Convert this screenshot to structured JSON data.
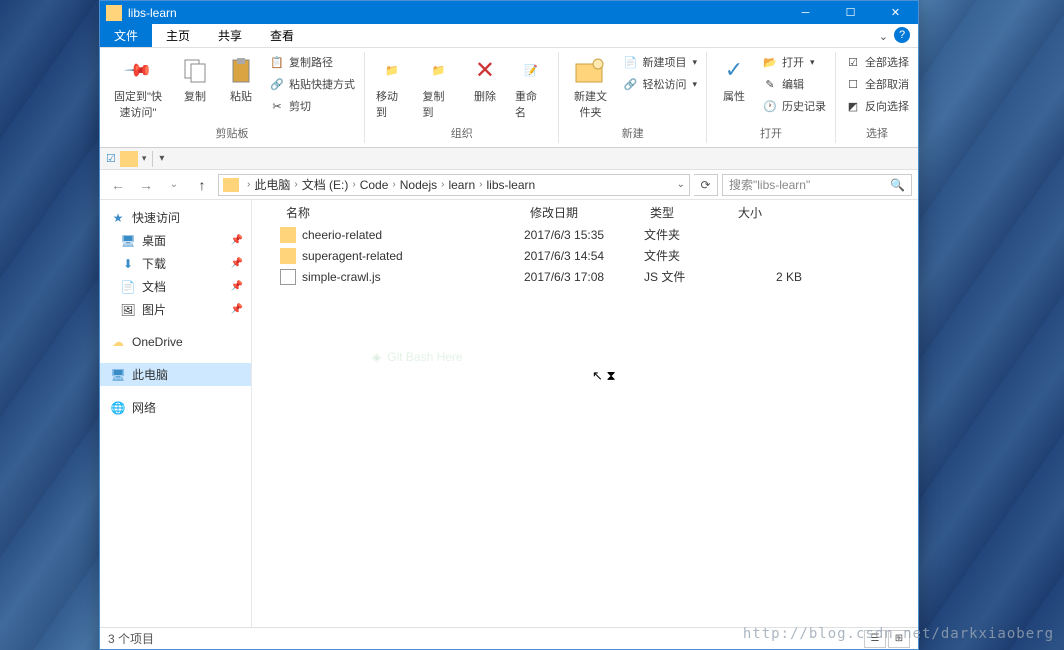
{
  "title": "libs-learn",
  "tabs": {
    "file": "文件",
    "home": "主页",
    "share": "共享",
    "view": "查看"
  },
  "ribbon": {
    "pin": "固定到\"快速访问\"",
    "copy": "复制",
    "paste": "粘贴",
    "copyPath": "复制路径",
    "pasteShortcut": "粘贴快捷方式",
    "cut": "剪切",
    "clipboard": "剪贴板",
    "moveTo": "移动到",
    "copyTo": "复制到",
    "delete": "删除",
    "rename": "重命名",
    "organize": "组织",
    "newFolder": "新建文件夹",
    "newItem": "新建项目",
    "easyAccess": "轻松访问",
    "new": "新建",
    "properties": "属性",
    "open": "打开",
    "edit": "编辑",
    "history": "历史记录",
    "openGroup": "打开",
    "selectAll": "全部选择",
    "selectNone": "全部取消",
    "invertSelection": "反向选择",
    "select": "选择"
  },
  "breadcrumb": [
    "此电脑",
    "文档 (E:)",
    "Code",
    "Nodejs",
    "learn",
    "libs-learn"
  ],
  "searchPlaceholder": "搜索\"libs-learn\"",
  "nav": {
    "quickAccess": "快速访问",
    "desktop": "桌面",
    "downloads": "下载",
    "documents": "文档",
    "pictures": "图片",
    "onedrive": "OneDrive",
    "thisPC": "此电脑",
    "network": "网络"
  },
  "columns": {
    "name": "名称",
    "date": "修改日期",
    "type": "类型",
    "size": "大小"
  },
  "files": [
    {
      "name": "cheerio-related",
      "date": "2017/6/3 15:35",
      "type": "文件夹",
      "size": "",
      "icon": "folder"
    },
    {
      "name": "superagent-related",
      "date": "2017/6/3 14:54",
      "type": "文件夹",
      "size": "",
      "icon": "folder"
    },
    {
      "name": "simple-crawl.js",
      "date": "2017/6/3 17:08",
      "type": "JS 文件",
      "size": "2 KB",
      "icon": "js"
    }
  ],
  "contextHint": "Git Bash Here",
  "status": "3 个项目",
  "watermark": "http://blog.csdn.net/darkxiaoberg"
}
